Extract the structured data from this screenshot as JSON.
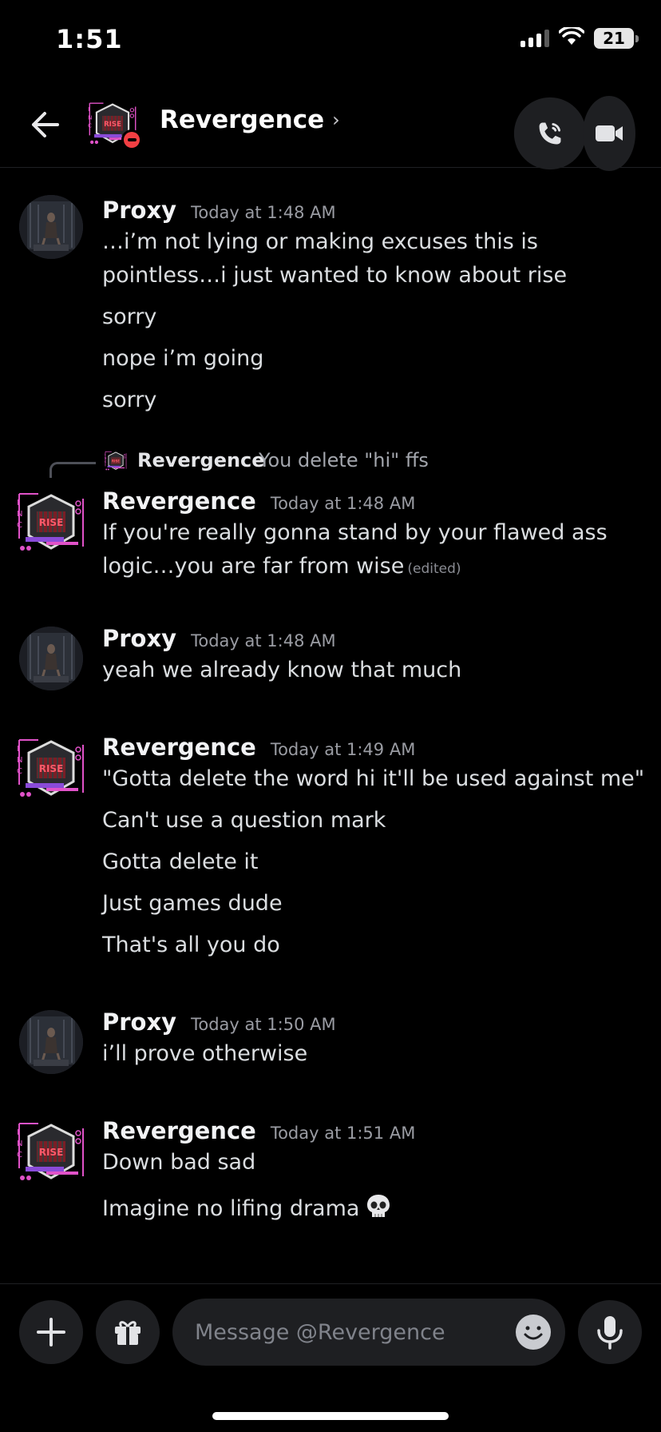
{
  "status_bar": {
    "time": "1:51",
    "battery": "21"
  },
  "header": {
    "title": "Revergence",
    "chevron": "›"
  },
  "groups": [
    {
      "author": "Proxy",
      "timestamp": "Today at 1:48 AM",
      "lines": [
        "…i’m not lying or making excuses this is",
        "pointless…i just wanted to know about rise",
        "sorry",
        "nope i’m going",
        "sorry"
      ]
    },
    {
      "reply": {
        "author": "Revergence",
        "text": "You delete \"hi\" ffs"
      },
      "author": "Revergence",
      "timestamp": "Today at 1:48 AM",
      "lines": [
        "If you're really gonna stand by your flawed ass",
        "logic…you are far from wise"
      ],
      "edited_label": "(edited)"
    },
    {
      "author": "Proxy",
      "timestamp": "Today at 1:48 AM",
      "lines": [
        "yeah we already know that much"
      ]
    },
    {
      "author": "Revergence",
      "timestamp": "Today at 1:49 AM",
      "lines": [
        "\"Gotta delete the word hi it'll be used against me\"",
        "Can't use a question mark",
        "Gotta delete it",
        "Just games dude",
        "That's all you do"
      ]
    },
    {
      "author": "Proxy",
      "timestamp": "Today at 1:50 AM",
      "lines": [
        "i’ll prove otherwise"
      ]
    },
    {
      "author": "Revergence",
      "timestamp": "Today at 1:51 AM",
      "lines": [
        "Down bad sad",
        "Imagine no lifing drama"
      ]
    }
  ],
  "composer": {
    "placeholder": "Message @Revergence"
  },
  "icons": {
    "back": "back-arrow-icon",
    "call": "phone-icon",
    "video": "video-camera-icon",
    "plus": "plus-icon",
    "gift": "gift-icon",
    "emoji": "emoji-icon",
    "mic": "microphone-icon",
    "skull": "skull-emoji"
  },
  "colors": {
    "background": "#000000",
    "dnd": "#f23f43",
    "button_bg": "#1e1f22"
  }
}
